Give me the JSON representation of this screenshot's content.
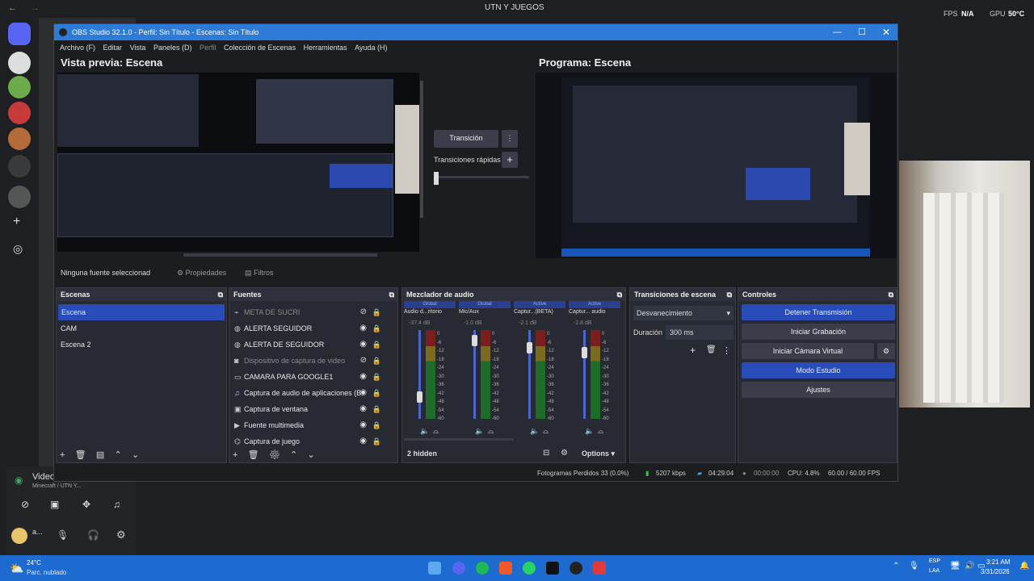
{
  "discord": {
    "channel_title": "UTN Y JUEGOS",
    "overlay_stats": {
      "fps_label": "FPS",
      "fps_value": "N/A",
      "gpu_label": "GPU",
      "gpu_value": "50°C"
    },
    "voice_title": "Video",
    "voice_sub": "Minecraft / UTN Y...",
    "user_initial": "a..."
  },
  "obs": {
    "title": "OBS Studio 32.1.0 - Perfil: Sin Título - Escenas: Sin Título",
    "menu": [
      "Archivo (F)",
      "Editar",
      "Vista",
      "Paneles (D)",
      "Perfil",
      "Colección de Escenas",
      "Herramientas",
      "Ayuda (H)"
    ],
    "preview_title": "Vista previa: Escena",
    "program_title": "Programa: Escena",
    "transition_btn": "Transición",
    "quick_transitions": "Transiciones rápidas",
    "no_source": "Ninguna fuente seleccionad",
    "properties_btn": "Propiedades",
    "filters_btn": "Filtros",
    "scenes": {
      "title": "Escenas",
      "items": [
        "Escena",
        "CAM",
        "Escena 2"
      ]
    },
    "sources": {
      "title": "Fuentes",
      "items": [
        {
          "name": "META DE SUCRI",
          "icon": "link-icon",
          "hidden": true
        },
        {
          "name": "ALERTA SEGUIDOR",
          "icon": "globe-icon",
          "hidden": false
        },
        {
          "name": "ALERTA DE SEGUIDOR",
          "icon": "globe-icon",
          "hidden": false
        },
        {
          "name": "Dispositivo de captura de video",
          "icon": "camera-icon",
          "hidden": true
        },
        {
          "name": "CAMARA PARA GOOGLE1",
          "icon": "monitor-icon",
          "hidden": false
        },
        {
          "name": "Captura de audio de aplicaciones (B",
          "icon": "audio-icon",
          "hidden": false
        },
        {
          "name": "Captura de ventana",
          "icon": "window-icon",
          "hidden": false
        },
        {
          "name": "Fuente multimedia",
          "icon": "play-icon",
          "hidden": false
        },
        {
          "name": "Captura de juego",
          "icon": "gamepad-icon",
          "hidden": false
        }
      ]
    },
    "mixer": {
      "title": "Mezclador de audio",
      "channels": [
        {
          "tag": "Global",
          "name": "Audio d...ritorio",
          "db": "-37.4 dB",
          "level": 0.25
        },
        {
          "tag": "Global",
          "name": "Mic/Aux",
          "db": "-1.0 dB",
          "level": 0.88
        },
        {
          "tag": "Active",
          "name": "Captur...(BETA)",
          "db": "-2.1 dB",
          "level": 0.8
        },
        {
          "tag": "Active",
          "name": "Captur... audio",
          "db": "-2.8 dB",
          "level": 0.75
        }
      ],
      "ticks": [
        "0",
        "-6",
        "-12",
        "-18",
        "-24",
        "-30",
        "-36",
        "-42",
        "-48",
        "-54",
        "-60"
      ],
      "hidden_count": "2 hidden",
      "options": "Options"
    },
    "transitions": {
      "title": "Transiciones de escena",
      "type": "Desvanecimiento",
      "duration_label": "Duración",
      "duration_value": "300 ms"
    },
    "controls": {
      "title": "Controles",
      "buttons": [
        "Detener Transmisión",
        "Iniciar Grabación",
        "Iniciar Cámara Virtual",
        "Modo Estudio",
        "Ajustes"
      ]
    },
    "status": {
      "dropped": "Fotogramas Perdidos 33 (0.0%)",
      "bitrate": "5207 kbps",
      "live_time": "04:29:04",
      "rec_time": "00:00:00",
      "cpu": "CPU: 4.8%",
      "fps": "60.00 / 60.00 FPS"
    }
  },
  "taskbar": {
    "weather_temp": "24°C",
    "weather_desc": "Parc. nublado",
    "lang_top": "ESP",
    "lang_bottom": "LAA",
    "time": "3:21 AM",
    "date": "3/31/2026"
  },
  "colors": {
    "obs_accent": "#284cb8",
    "title_bar": "#2d7bd6",
    "taskbar": "#1d6bd0"
  }
}
